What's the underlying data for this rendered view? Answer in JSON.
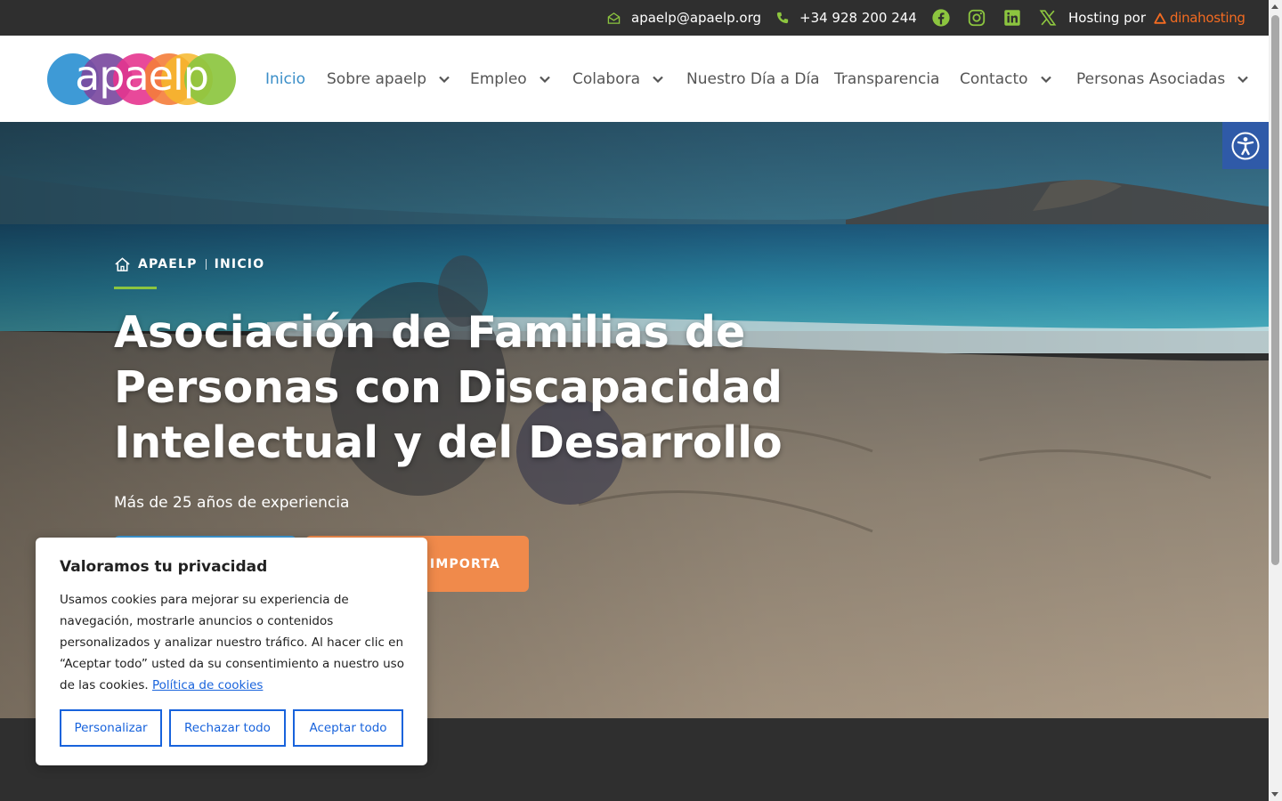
{
  "topbar": {
    "email": "apaelp@apaelp.org",
    "phone": "+34 928 200 244",
    "hosting_label": "Hosting por",
    "hosting_brand": "dinahosting",
    "social": [
      "facebook-icon",
      "instagram-icon",
      "linkedin-icon",
      "x-icon"
    ]
  },
  "logo": {
    "text": "apaelp"
  },
  "nav": {
    "items": [
      {
        "label": "Inicio",
        "active": true,
        "dropdown": false
      },
      {
        "label": "Sobre apaelp",
        "dropdown": true
      },
      {
        "label": "Empleo",
        "dropdown": true
      },
      {
        "label": "Colabora",
        "dropdown": true
      },
      {
        "label": "Nuestro Día a Día",
        "dropdown": false
      },
      {
        "label": "Transparencia",
        "dropdown": false
      },
      {
        "label": "Contacto",
        "dropdown": true
      },
      {
        "label": "Personas Asociadas",
        "dropdown": true
      }
    ]
  },
  "hero": {
    "breadcrumb": [
      "APAELP",
      "INICIO"
    ],
    "title": "Asociación de Familias de Personas con Discapacidad Intelectual y del Desarrollo",
    "subtitle": "Más de 25 años de experiencia",
    "button_orange": "IMPORTA"
  },
  "cookie": {
    "title": "Valoramos tu privacidad",
    "text": "Usamos cookies para mejorar su experiencia de navegación, mostrarle anuncios o contenidos personalizados y analizar nuestro tráfico. Al hacer clic en “Aceptar todo” usted da su consentimiento a nuestro uso de las cookies.",
    "link": "Política de cookies",
    "buttons": {
      "customize": "Personalizar",
      "reject": "Rechazar todo",
      "accept": "Aceptar todo"
    }
  },
  "colors": {
    "accent_green": "#8cc53f",
    "nav_active": "#3a8ec8",
    "button_blue": "#3e9ad6",
    "button_orange": "#f08a4b",
    "cookie_blue": "#1863dc",
    "dinahosting_orange": "#f36b21"
  }
}
